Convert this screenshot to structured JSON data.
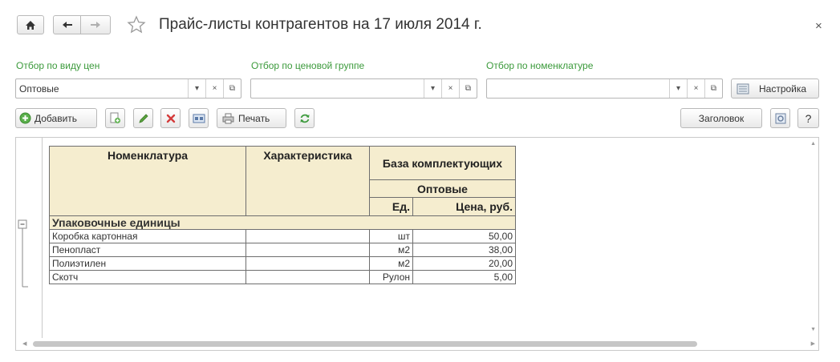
{
  "window": {
    "title": "Прайс-листы контрагентов на 17 июля 2014 г.",
    "close": "×"
  },
  "filters": [
    {
      "label": "Отбор по виду цен",
      "value": "Оптовые"
    },
    {
      "label": "Отбор по ценовой группе",
      "value": ""
    },
    {
      "label": "Отбор по номенклатуре",
      "value": ""
    }
  ],
  "settings_label": "Настройка",
  "toolbar": {
    "add_label": "Добавить",
    "print_label": "Печать",
    "header_label": "Заголовок",
    "help_label": "?"
  },
  "report": {
    "headers": {
      "nomenclature": "Номенклатура",
      "characteristic": "Характеристика",
      "base": "База комплектующих",
      "price_type": "Оптовые",
      "unit": "Ед.",
      "price": "Цена, руб."
    },
    "group": "Упаковочные единицы",
    "rows": [
      {
        "name": "Коробка картонная",
        "char": "",
        "unit": "шт",
        "price": "50,00"
      },
      {
        "name": "Пенопласт",
        "char": "",
        "unit": "м2",
        "price": "38,00"
      },
      {
        "name": "Полиэтилен",
        "char": "",
        "unit": "м2",
        "price": "20,00"
      },
      {
        "name": "Скотч",
        "char": "",
        "unit": "Рулон",
        "price": "5,00"
      }
    ]
  },
  "colors": {
    "filter_label": "#3b9a3b",
    "header_bg": "#f5edcf"
  }
}
